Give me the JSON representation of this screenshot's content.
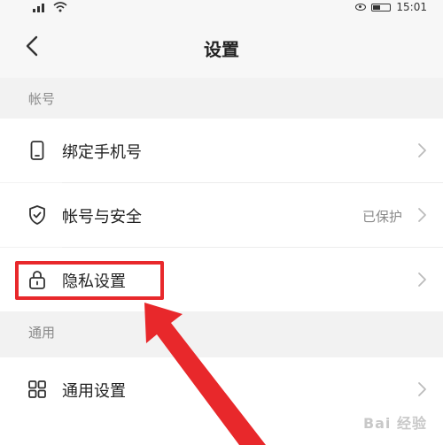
{
  "status_bar": {
    "time": "15:01"
  },
  "header": {
    "title": "设置",
    "back_icon": "chevron-left-icon"
  },
  "sections": {
    "account": {
      "header": "帐号",
      "items": [
        {
          "label": "绑定手机号",
          "icon": "phone-icon",
          "value": ""
        },
        {
          "label": "帐号与安全",
          "icon": "shield-check-icon",
          "value": "已保护"
        },
        {
          "label": "隐私设置",
          "icon": "lock-icon",
          "value": ""
        }
      ]
    },
    "general": {
      "header": "通用",
      "items": [
        {
          "label": "通用设置",
          "icon": "grid-icon",
          "value": ""
        }
      ]
    }
  },
  "annotation": {
    "highlight_color": "#e8282b"
  },
  "watermark": {
    "text": "Bai 经验"
  }
}
